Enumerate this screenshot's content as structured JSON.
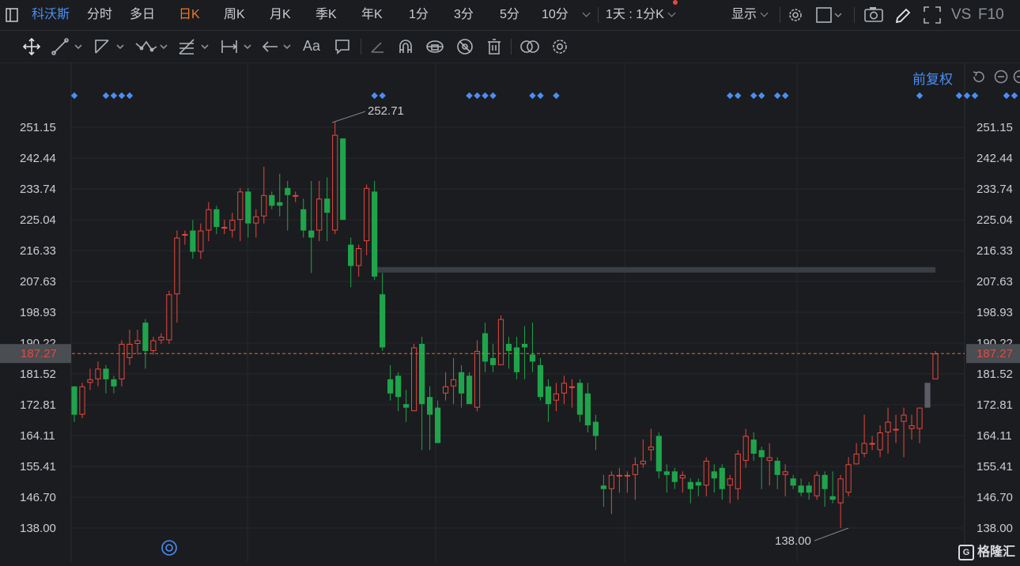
{
  "topbar": {
    "stock_name": "科沃斯",
    "tabs": [
      "分时",
      "多日",
      "日K",
      "周K",
      "月K",
      "季K",
      "年K",
      "1分",
      "3分",
      "5分",
      "10分"
    ],
    "active_tab": "日K",
    "period_select": "1天 : 1分K",
    "display_label": "显示",
    "vs_label": "VS",
    "f10_label": "F10"
  },
  "restore_label": "前复权",
  "brand_label": "格隆汇",
  "colors": {
    "up": "#e5483f",
    "down": "#1fa44c",
    "accent": "#4a8ef5",
    "price_line": "#e06a3a"
  },
  "chart_data": {
    "type": "candlestick",
    "y_ticks": [
      "251.15",
      "242.44",
      "233.74",
      "225.04",
      "216.33",
      "207.63",
      "198.93",
      "190.22",
      "181.52",
      "172.81",
      "164.11",
      "155.41",
      "146.70",
      "138.00"
    ],
    "ylim": [
      138.0,
      251.15
    ],
    "current_price": "187.27",
    "high_label": "252.71",
    "low_label": "138.00",
    "resistance_level": 210.8,
    "candles": [
      [
        178,
        170,
        178,
        168
      ],
      [
        170,
        178,
        179,
        169
      ],
      [
        179,
        180,
        183,
        177
      ],
      [
        180,
        183,
        185,
        178
      ],
      [
        183,
        180,
        184,
        176
      ],
      [
        180,
        178,
        181,
        176
      ],
      [
        180,
        190,
        191,
        178
      ],
      [
        186,
        190,
        194,
        184
      ],
      [
        190,
        191,
        194,
        187
      ],
      [
        196,
        188,
        197,
        183
      ],
      [
        188,
        191,
        192,
        187
      ],
      [
        191,
        192,
        193,
        190
      ],
      [
        191,
        204,
        205,
        190
      ],
      [
        204,
        220,
        222,
        196
      ],
      [
        221,
        221,
        222,
        218
      ],
      [
        222,
        216,
        225,
        214
      ],
      [
        216,
        222,
        224,
        214
      ],
      [
        222,
        228,
        230,
        219
      ],
      [
        228,
        223,
        229,
        221
      ],
      [
        223,
        223,
        225,
        221
      ],
      [
        222,
        225,
        227,
        220
      ],
      [
        225,
        233,
        234,
        219
      ],
      [
        233,
        224,
        234,
        220
      ],
      [
        224,
        226,
        228,
        220
      ],
      [
        226,
        232,
        240,
        224
      ],
      [
        232,
        229,
        233,
        228
      ],
      [
        230,
        229,
        238,
        226
      ],
      [
        234,
        232,
        236,
        222
      ],
      [
        232,
        232,
        233,
        230
      ],
      [
        228,
        222,
        231,
        220
      ],
      [
        222,
        220,
        236,
        210
      ],
      [
        222,
        231,
        236,
        219
      ],
      [
        231,
        227,
        237,
        219
      ],
      [
        222,
        249,
        252.71,
        221
      ],
      [
        248,
        225,
        248,
        225
      ],
      [
        218,
        212,
        220,
        206
      ],
      [
        212,
        217,
        218,
        209
      ],
      [
        219,
        234,
        235,
        215
      ],
      [
        233,
        209,
        236,
        208
      ],
      [
        204,
        189,
        210,
        188
      ],
      [
        180,
        176,
        184,
        174
      ],
      [
        181,
        175,
        182,
        171
      ],
      [
        173,
        172,
        177,
        168
      ],
      [
        171,
        189,
        190,
        171
      ],
      [
        190,
        173,
        192,
        160
      ],
      [
        175,
        170,
        178,
        160
      ],
      [
        172,
        162,
        174,
        162
      ],
      [
        176,
        178,
        182,
        174
      ],
      [
        178,
        180,
        186,
        173
      ],
      [
        182,
        176,
        184,
        172
      ],
      [
        181,
        173,
        182,
        173
      ],
      [
        172,
        188,
        191,
        171
      ],
      [
        193,
        185,
        196,
        182
      ],
      [
        186,
        184,
        190,
        182
      ],
      [
        184,
        197,
        198,
        186
      ],
      [
        190,
        188,
        192,
        183
      ],
      [
        189,
        182,
        192,
        180
      ],
      [
        190,
        189,
        195,
        180
      ],
      [
        187,
        185,
        196,
        182
      ],
      [
        184,
        175,
        186,
        174
      ],
      [
        178,
        173,
        180,
        168
      ],
      [
        174,
        176,
        179,
        171
      ],
      [
        176,
        179,
        181,
        173
      ],
      [
        178,
        178,
        180,
        172
      ],
      [
        179,
        170,
        180,
        168
      ],
      [
        176,
        167,
        179,
        165
      ],
      [
        168,
        164,
        170,
        160
      ],
      [
        150,
        149,
        153,
        144
      ],
      [
        149,
        153,
        154,
        142
      ],
      [
        153,
        153,
        155,
        148
      ],
      [
        153,
        153,
        154,
        148
      ],
      [
        153,
        156,
        158,
        146
      ],
      [
        156,
        157,
        163,
        155
      ],
      [
        160,
        161,
        166,
        157
      ],
      [
        164,
        154,
        165,
        152
      ],
      [
        154,
        153,
        156,
        148
      ],
      [
        154,
        151,
        155,
        149
      ],
      [
        152,
        153,
        154,
        148
      ],
      [
        151,
        149,
        152,
        145
      ],
      [
        151,
        150,
        152,
        147
      ],
      [
        150,
        157,
        158,
        147
      ],
      [
        154,
        152,
        156,
        148
      ],
      [
        155,
        149,
        156,
        146
      ],
      [
        150,
        152,
        153,
        145
      ],
      [
        149,
        159,
        160,
        146
      ],
      [
        157,
        164,
        166,
        155
      ],
      [
        163,
        159,
        165,
        157
      ],
      [
        160,
        158,
        161,
        149
      ],
      [
        157,
        158,
        162,
        150
      ],
      [
        157,
        153,
        158,
        149
      ],
      [
        153,
        154,
        156,
        147
      ],
      [
        152,
        150,
        153,
        149
      ],
      [
        150,
        148,
        152,
        147
      ],
      [
        150,
        148,
        151,
        146
      ],
      [
        147,
        153,
        154,
        146
      ],
      [
        153,
        149,
        154,
        144
      ],
      [
        147,
        146,
        154,
        145
      ],
      [
        145,
        152,
        153,
        138
      ],
      [
        148,
        156,
        158,
        147
      ],
      [
        156,
        159,
        162,
        156
      ],
      [
        159,
        162,
        170,
        158
      ],
      [
        162,
        162,
        164,
        160
      ],
      [
        160,
        165,
        167,
        158
      ],
      [
        165,
        168,
        172,
        159
      ],
      [
        166,
        166,
        170,
        162
      ],
      [
        168,
        170,
        172,
        158
      ],
      [
        166,
        167,
        170,
        163
      ],
      [
        166,
        172,
        172,
        162
      ],
      [
        172,
        179,
        179,
        172
      ],
      [
        180,
        187.27,
        188,
        180
      ]
    ]
  }
}
